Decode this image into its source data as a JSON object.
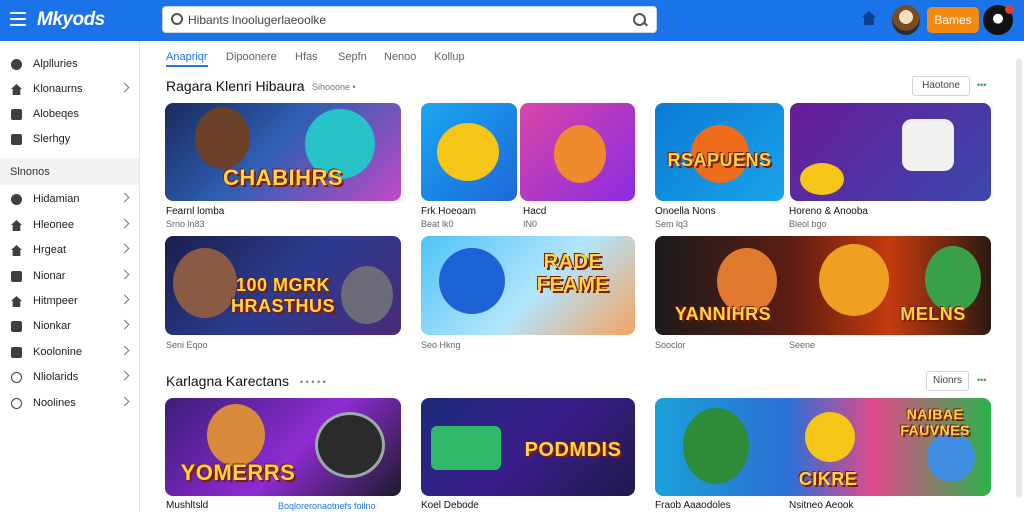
{
  "topbar": {
    "logo": "Mkyods",
    "search_value": "Hibants lnoolugerlaeoolke",
    "cta_label": "Bames"
  },
  "sidebar": {
    "items_top": [
      {
        "label": "Alplluries",
        "icon": "circle-icon",
        "chevron": false
      },
      {
        "label": "Klonaurns",
        "icon": "home-icon",
        "chevron": true
      },
      {
        "label": "Alobeqes",
        "icon": "square-icon",
        "chevron": false
      },
      {
        "label": "Slerhgy",
        "icon": "square-icon",
        "chevron": false
      }
    ],
    "section_label": "Slnonos",
    "items_bottom": [
      {
        "label": "Hidamian",
        "icon": "circle-icon",
        "chevron": true
      },
      {
        "label": "Hleonee",
        "icon": "home-icon",
        "chevron": true
      },
      {
        "label": "Hrgeat",
        "icon": "home-icon",
        "chevron": true
      },
      {
        "label": "Nionar",
        "icon": "square-icon",
        "chevron": true
      },
      {
        "label": "Hitmpeer",
        "icon": "home-icon",
        "chevron": true
      },
      {
        "label": "Nionkar",
        "icon": "square-icon",
        "chevron": true
      },
      {
        "label": "Koolonine",
        "icon": "square-icon",
        "chevron": true
      },
      {
        "label": "Nliolarids",
        "icon": "ring-icon",
        "chevron": true
      },
      {
        "label": "Noolines",
        "icon": "ring-icon",
        "chevron": true
      }
    ]
  },
  "tabs": [
    "Anapriqr",
    "Dipoonere",
    "Hfas",
    "Sepfn",
    "Nenoo",
    "Kollup"
  ],
  "section1": {
    "title": "Ragara Klenri Hibaura",
    "subtitle": "Sihooone •",
    "button": "Haotone",
    "more": "•••",
    "cards": [
      {
        "text": "CHABIHRS",
        "caption": "Fearnl lomba",
        "sub": "Srno ln83",
        "link": ""
      },
      {
        "text": "",
        "caption": "Frk Hoeoam",
        "sub": "Beat lk0",
        "link": ""
      },
      {
        "text": "",
        "caption": "Hacd",
        "sub": "IN0",
        "link": ""
      },
      {
        "text": "RSAPUENS",
        "caption": "Onoella Nons",
        "sub": "Sem lq3",
        "link": ""
      },
      {
        "text": "",
        "caption": "Horeno & Anooba",
        "sub": "Bleol bgo",
        "link": ""
      }
    ],
    "row2": [
      {
        "text": "100 MGRK HRASTHUS",
        "caption": "Seni Eqoo"
      },
      {
        "text": "RADE FEAME",
        "caption": "Seo Hkng"
      },
      {
        "text": "YANNIHRS",
        "caption": "Sooclor"
      },
      {
        "text": "MELNS",
        "caption": "Seene"
      }
    ]
  },
  "section2": {
    "title": "Karlagna Karectans",
    "subtitle": "• • • • •",
    "button": "Nionrs",
    "more": "•••",
    "cards": [
      {
        "text": "YOMERRS",
        "caption": "Mushltsld",
        "link": "Boqloreronaotnefs foilno"
      },
      {
        "text": "PODMDIS",
        "caption": "Koel Debode",
        "link": ""
      },
      {
        "text": "CIKRE",
        "caption": "Fraob Aaaodoles",
        "link": ""
      },
      {
        "text": "NAIBAE FAUVNES",
        "caption": "Nsitneo Aeook",
        "link": ""
      }
    ]
  },
  "colors": {
    "accent": "#1a73e8",
    "cta": "#f58a12"
  }
}
